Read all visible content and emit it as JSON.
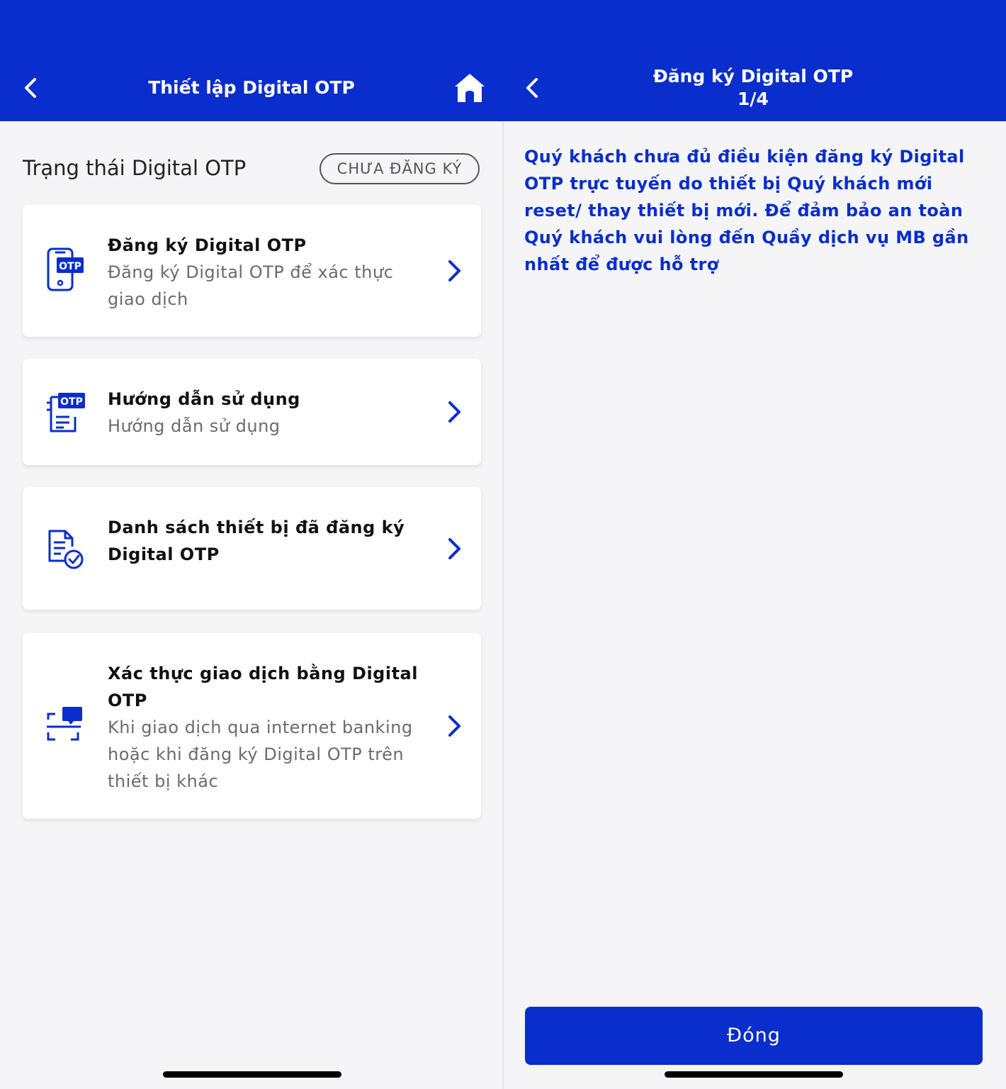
{
  "left": {
    "header": {
      "title": "Thiết lập Digital OTP"
    },
    "status": {
      "label": "Trạng thái Digital OTP",
      "badge": "CHƯA ĐĂNG KÝ"
    },
    "cards": [
      {
        "title": "Đăng ký Digital OTP",
        "desc": "Đăng ký Digital OTP để xác thực giao dịch",
        "icon": "otp-phone-icon"
      },
      {
        "title": "Hướng dẫn sử dụng",
        "desc": "Hướng dẫn sử dụng",
        "icon": "otp-guide-icon"
      },
      {
        "title": "Danh sách thiết bị đã đăng ký Digital OTP",
        "desc": "",
        "icon": "device-list-check-icon"
      },
      {
        "title": "Xác thực giao dịch bằng Digital OTP",
        "desc": "Khi giao dịch qua internet banking hoặc khi đăng ký Digital OTP trên thiết bị khác",
        "icon": "scan-verify-icon"
      }
    ]
  },
  "right": {
    "header": {
      "title": "Đăng ký Digital OTP",
      "step": "1/4"
    },
    "message": "Quý khách chưa đủ điều kiện đăng ký Digital OTP trực tuyến do thiết bị Quý khách mới reset/ thay thiết bị mới. Để đảm bảo an toàn Quý khách vui lòng đến Quầy dịch vụ MB gần nhất để được hỗ trợ",
    "close_button": "Đóng"
  },
  "colors": {
    "brand": "#0a2ecb",
    "background": "#f5f5f7",
    "card": "#ffffff"
  }
}
